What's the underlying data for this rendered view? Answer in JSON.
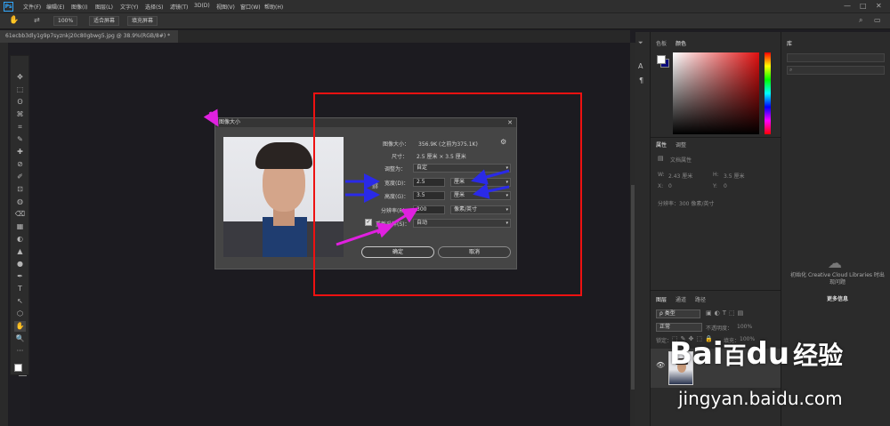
{
  "app": {
    "logo": "Ps"
  },
  "menu": [
    "文件(F)",
    "编辑(E)",
    "图像(I)",
    "图层(L)",
    "文字(Y)",
    "选择(S)",
    "滤镜(T)",
    "3D(D)",
    "视图(V)",
    "窗口(W)",
    "帮助(H)"
  ],
  "window_controls": [
    "—",
    "□",
    "✕"
  ],
  "options_bar": {
    "zoom": "100%",
    "fit_screen": "适合屏幕",
    "fill_screen": "填充屏幕"
  },
  "document_tab": "61ecbb3dly1g9p7syznkj20c80gbwg5.jpg @ 38.9%(RGB/8#) *",
  "tools": [
    "✥",
    "⬚",
    "ʘ",
    "⌘",
    "⌗",
    "✎",
    "✚",
    "⊘",
    "✐",
    "⊡",
    "◍",
    "⌫",
    "▦",
    "◐",
    "▲",
    "●",
    "✒",
    "T",
    "↖",
    "⬡",
    "✋",
    "🔍",
    "···"
  ],
  "color_panel": {
    "tabs": [
      "色板",
      "颜色"
    ],
    "active": "颜色"
  },
  "properties_panel": {
    "tabs": [
      "属性",
      "调整"
    ],
    "doc_label": "文档属性",
    "w_label": "W:",
    "w_value": "2.43 厘米",
    "h_label": "H:",
    "h_value": "3.5 厘米",
    "x_label": "X:",
    "x_value": "0",
    "y_label": "Y:",
    "y_value": "0",
    "resolution": "分辨率：300 像素/英寸"
  },
  "libraries_panel": {
    "tab": "库",
    "message": "初始化 Creative Cloud Libraries 时出现问题",
    "more": "更多信息"
  },
  "layers_panel": {
    "tabs": [
      "图层",
      "通道",
      "路径"
    ],
    "filter_label": "ρ 类型",
    "blend": "正常",
    "opacity_label": "不透明度：",
    "opacity": "100%",
    "lock_label": "锁定：",
    "fill_label": "填充：",
    "fill": "100%"
  },
  "dialog": {
    "title": "图像大小",
    "size_label": "图像大小：",
    "size_value": "356.9K (之前为375.1K)",
    "dims_label": "尺寸：",
    "dims_value": "2.5 厘米 × 3.5 厘米",
    "fit_label": "调整为：",
    "fit_value": "自定",
    "width_label": "宽度(D)：",
    "width_value": "2.5",
    "width_unit": "厘米",
    "height_label": "高度(G)：",
    "height_value": "3.5",
    "height_unit": "厘米",
    "res_label": "分辨率(R)：",
    "res_value": "300",
    "res_unit": "像素/英寸",
    "resample_label": "重新采样(S)：",
    "resample_value": "自动",
    "ok": "确定",
    "cancel": "取消"
  },
  "watermark": {
    "brand": "Bai",
    "brand2": "百",
    "brand3": "du",
    "cn": "经验",
    "url": "jingyan.baidu.com"
  },
  "colors": {
    "annotation_box": "#e11111",
    "arrow_blue": "#2a2ae8",
    "arrow_magenta": "#e020e0"
  }
}
